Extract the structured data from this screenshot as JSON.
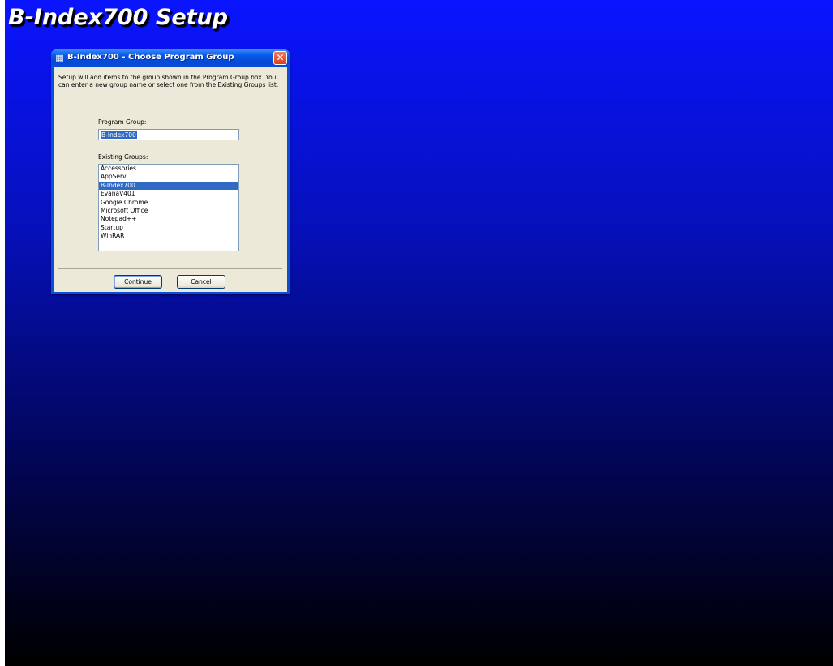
{
  "background": {
    "title": "B-Index700 Setup"
  },
  "dialog": {
    "title": "B-Index700 - Choose Program Group",
    "icon": "setup-icon",
    "intro": "Setup will add items to the group shown in the Program Group box. You can enter a new group name or select one from the Existing Groups list.",
    "program_group_label": "Program Group:",
    "program_group_value": "B-Index700",
    "existing_groups_label": "Existing Groups:",
    "existing_groups": [
      "Accessories",
      "AppServ",
      "B-Index700",
      "EvanaV401",
      "Google Chrome",
      "Microsoft Office",
      "Notepad++",
      "Startup",
      "WinRAR"
    ],
    "selected_group": "B-Index700",
    "continue_label": "Continue",
    "cancel_label": "Cancel",
    "close_label": "✕"
  },
  "colors": {
    "background_top": "#0a14ff",
    "background_bottom": "#000000",
    "titlebar": "#0a4fd8",
    "selection": "#316ac5",
    "dialog_face": "#ece9d8"
  }
}
